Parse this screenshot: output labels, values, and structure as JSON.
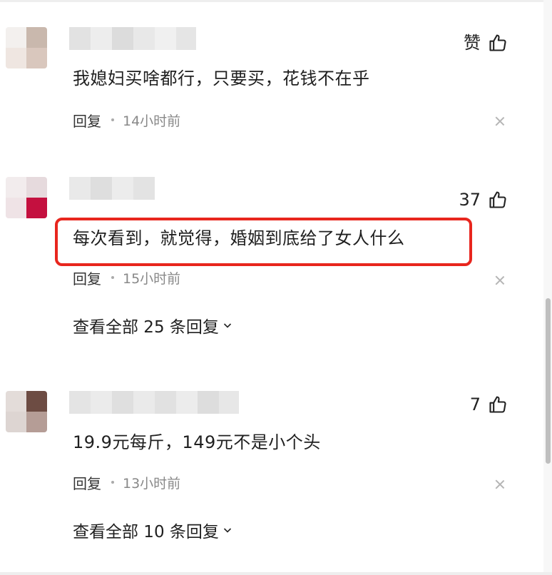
{
  "colors": {
    "highlight": "#e8261e",
    "scroll_thumb": "#bfbfbf",
    "muted": "#888888"
  },
  "comments": [
    {
      "likes": "赞",
      "text": "我媳妇买啥都行，只要买，花钱不在乎",
      "reply_label": "回复",
      "time": "14小时前"
    },
    {
      "likes": "37",
      "text": "每次看到，就觉得，婚姻到底给了女人什么",
      "reply_label": "回复",
      "time": "15小时前",
      "view_replies": "查看全部 25 条回复"
    },
    {
      "likes": "7",
      "text": "19.9元每斤，149元不是小个头",
      "reply_label": "回复",
      "time": "13小时前",
      "view_replies": "查看全部 10 条回复"
    }
  ],
  "icons": {
    "like": "thumbs-up-icon",
    "close": "close-icon",
    "expand": "chevron-down-icon"
  }
}
